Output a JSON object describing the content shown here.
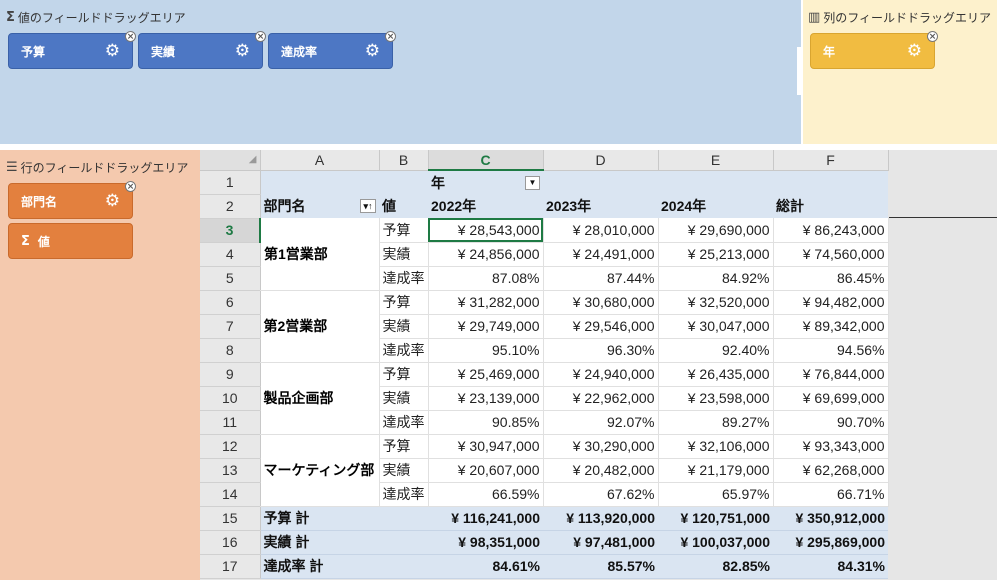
{
  "values_zone": {
    "title": "値のフィールドドラッグエリア",
    "icon": "sigma-icon",
    "chips": [
      {
        "label": "予算"
      },
      {
        "label": "実績"
      },
      {
        "label": "達成率"
      }
    ]
  },
  "columns_zone": {
    "title": "列のフィールドドラッグエリア",
    "icon": "columns-icon",
    "chips": [
      {
        "label": "年"
      }
    ]
  },
  "rows_zone": {
    "title": "行のフィールドドラッグエリア",
    "icon": "rows-icon",
    "chips": [
      {
        "label": "部門名"
      },
      {
        "label": "値",
        "prefix": "Σ"
      }
    ]
  },
  "sheet": {
    "columns": [
      "A",
      "B",
      "C",
      "D",
      "E",
      "F"
    ],
    "active_column": "C",
    "active_row": 3,
    "row_numbers": [
      "1",
      "2",
      "3",
      "4",
      "5",
      "6",
      "7",
      "8",
      "9",
      "10",
      "11",
      "12",
      "13",
      "14",
      "15",
      "16",
      "17"
    ],
    "header_row1": {
      "c": "年"
    },
    "header_row2": {
      "a": "部門名",
      "b": "値",
      "c": "2022年",
      "d": "2023年",
      "e": "2024年",
      "f": "総計"
    },
    "groups": [
      {
        "name": "第1営業部",
        "rows": [
          {
            "measure": "予算",
            "values": [
              "¥ 28,543,000",
              "¥ 28,010,000",
              "¥ 29,690,000",
              "¥ 86,243,000"
            ]
          },
          {
            "measure": "実績",
            "values": [
              "¥ 24,856,000",
              "¥ 24,491,000",
              "¥ 25,213,000",
              "¥ 74,560,000"
            ]
          },
          {
            "measure": "達成率",
            "values": [
              "87.08%",
              "87.44%",
              "84.92%",
              "86.45%"
            ]
          }
        ]
      },
      {
        "name": "第2営業部",
        "rows": [
          {
            "measure": "予算",
            "values": [
              "¥ 31,282,000",
              "¥ 30,680,000",
              "¥ 32,520,000",
              "¥ 94,482,000"
            ]
          },
          {
            "measure": "実績",
            "values": [
              "¥ 29,749,000",
              "¥ 29,546,000",
              "¥ 30,047,000",
              "¥ 89,342,000"
            ]
          },
          {
            "measure": "達成率",
            "values": [
              "95.10%",
              "96.30%",
              "92.40%",
              "94.56%"
            ]
          }
        ]
      },
      {
        "name": "製品企画部",
        "rows": [
          {
            "measure": "予算",
            "values": [
              "¥ 25,469,000",
              "¥ 24,940,000",
              "¥ 26,435,000",
              "¥ 76,844,000"
            ]
          },
          {
            "measure": "実績",
            "values": [
              "¥ 23,139,000",
              "¥ 22,962,000",
              "¥ 23,598,000",
              "¥ 69,699,000"
            ]
          },
          {
            "measure": "達成率",
            "values": [
              "90.85%",
              "92.07%",
              "89.27%",
              "90.70%"
            ]
          }
        ]
      },
      {
        "name": "マーケティング部",
        "rows": [
          {
            "measure": "予算",
            "values": [
              "¥ 30,947,000",
              "¥ 30,290,000",
              "¥ 32,106,000",
              "¥ 93,343,000"
            ]
          },
          {
            "measure": "実績",
            "values": [
              "¥ 20,607,000",
              "¥ 20,482,000",
              "¥ 21,179,000",
              "¥ 62,268,000"
            ]
          },
          {
            "measure": "達成率",
            "values": [
              "66.59%",
              "67.62%",
              "65.97%",
              "66.71%"
            ]
          }
        ]
      }
    ],
    "totals": [
      {
        "label": "予算 計",
        "values": [
          "¥ 116,241,000",
          "¥ 113,920,000",
          "¥ 120,751,000",
          "¥ 350,912,000"
        ]
      },
      {
        "label": "実績 計",
        "values": [
          "¥ 98,351,000",
          "¥ 97,481,000",
          "¥ 100,037,000",
          "¥ 295,869,000"
        ]
      },
      {
        "label": "達成率 計",
        "values": [
          "84.61%",
          "85.57%",
          "82.85%",
          "84.31%"
        ]
      }
    ]
  },
  "colors": {
    "values_zone": "#c2d6ea",
    "columns_zone": "#fdf1cc",
    "rows_zone": "#f4c9ae",
    "chip_blue": "#4d77c4",
    "chip_yellow": "#f1bc41",
    "chip_orange": "#e3803e",
    "header_fill": "#dae5f2",
    "active_green": "#1e7a44"
  }
}
